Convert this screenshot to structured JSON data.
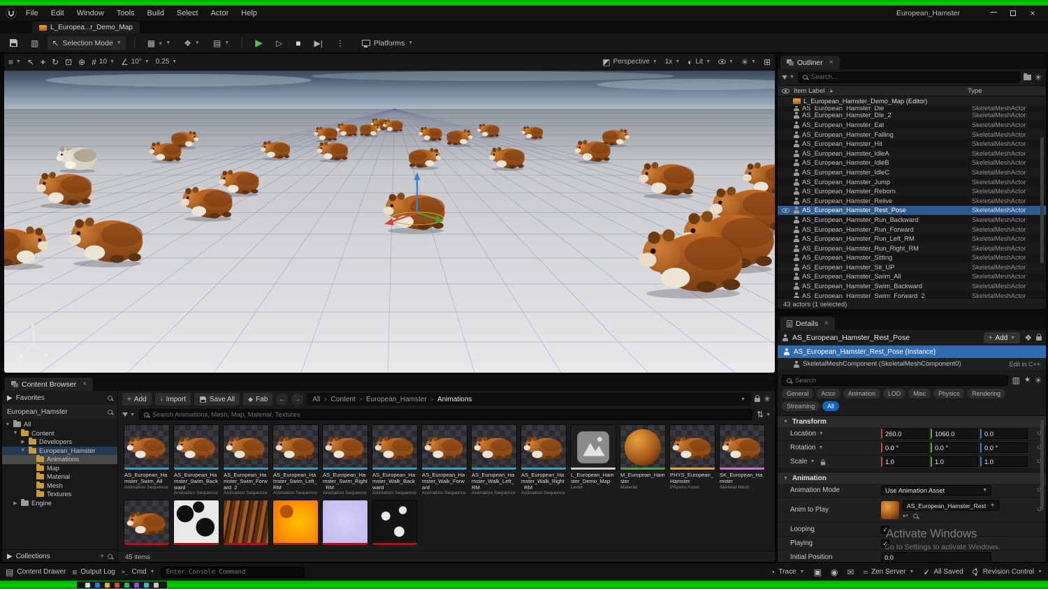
{
  "colors": {
    "accent": "#0070e0",
    "selection_blue": "#2d5a8c",
    "capture_green": "#00c300",
    "play_green": "#58c043",
    "stripes": {
      "anim": "#2f9fd0",
      "level": "#cfcfcf",
      "material": "#3fae49",
      "phys": "#e8a33c",
      "skel": "#d873d8",
      "texture": "#9c1b1b"
    }
  },
  "titlebar": {
    "menus": [
      "File",
      "Edit",
      "Window",
      "Tools",
      "Build",
      "Select",
      "Actor",
      "Help"
    ],
    "project_title": "European_Hamster"
  },
  "tabbar": {
    "level_tab": "L_Europea...r_Demo_Map"
  },
  "main_toolbar": {
    "selection_mode": "Selection Mode",
    "platforms": "Platforms"
  },
  "viewport_toolbar": {
    "perspective": "Perspective",
    "camera_speed": "1x",
    "view_mode": "Lit",
    "snap_move": "10",
    "snap_rotate": "10°",
    "snap_scale": "0.25"
  },
  "scene": {
    "axis": [
      "z",
      "x",
      "y"
    ],
    "gizmo": [
      592,
      196
    ],
    "hamsters": [
      [
        540,
        78,
        0.3,
        "n",
        0
      ],
      [
        558,
        80,
        0.31,
        "n",
        0
      ],
      [
        492,
        86,
        0.33,
        "n",
        0
      ],
      [
        524,
        86,
        0.32,
        "n",
        1
      ],
      [
        695,
        87,
        0.34,
        "n",
        0
      ],
      [
        758,
        90,
        0.33,
        "n",
        0
      ],
      [
        462,
        92,
        0.36,
        "n",
        0
      ],
      [
        612,
        92,
        0.36,
        "n",
        0
      ],
      [
        652,
        97,
        0.4,
        "n",
        1
      ],
      [
        876,
        97,
        0.42,
        "n",
        1
      ],
      [
        258,
        100,
        0.42,
        "n",
        1
      ],
      [
        390,
        115,
        0.45,
        "n",
        0
      ],
      [
        472,
        117,
        0.48,
        "n",
        0
      ],
      [
        845,
        117,
        0.55,
        "n",
        0
      ],
      [
        232,
        118,
        0.5,
        "n",
        0
      ],
      [
        602,
        127,
        0.5,
        "n",
        1
      ],
      [
        722,
        127,
        0.55,
        "n",
        0
      ],
      [
        105,
        128,
        0.62,
        "w",
        0
      ],
      [
        1098,
        157,
        0.8,
        "n",
        0
      ],
      [
        952,
        158,
        0.85,
        "n",
        0
      ],
      [
        338,
        162,
        0.62,
        "n",
        0
      ],
      [
        88,
        172,
        0.85,
        "n",
        0
      ],
      [
        292,
        192,
        0.8,
        "n",
        0
      ],
      [
        1068,
        203,
        1.15,
        "n",
        0
      ],
      [
        590,
        205,
        0.95,
        "n",
        0
      ],
      [
        148,
        247,
        1.15,
        "n",
        0
      ],
      [
        1040,
        247,
        1.45,
        "n",
        0
      ],
      [
        15,
        255,
        1.0,
        "n",
        1
      ],
      [
        988,
        278,
        1.6,
        "n",
        0
      ]
    ]
  },
  "outliner": {
    "tab": "Outliner",
    "search_placeholder": "Search...",
    "col_item": "Item Label",
    "col_type": "Type",
    "world_row": "L_European_Hamster_Demo_Map (Editor)",
    "partial_top": "AS_European_Hamster_Die",
    "type_label": "SkeletalMeshActor",
    "selected": "AS_European_Hamster_Rest_Pose",
    "rows": [
      "AS_European_Hamster_Die_2",
      "AS_European_Hamster_Eat",
      "AS_European_Hamster_Falling",
      "AS_European_Hamster_Hit",
      "AS_European_Hamster_IdleA",
      "AS_European_Hamster_IdleB",
      "AS_European_Hamster_IdleC",
      "AS_European_Hamster_Jump",
      "AS_European_Hamster_Reborn",
      "AS_European_Hamster_Relive",
      "AS_European_Hamster_Rest_Pose",
      "AS_European_Hamster_Run_Backward",
      "AS_European_Hamster_Run_Forward",
      "AS_European_Hamster_Run_Left_RM",
      "AS_European_Hamster_Run_Right_RM",
      "AS_European_Hamster_Sitting",
      "AS_European_Hamster_Sit_UP",
      "AS_European_Hamster_Swim_All",
      "AS_European_Hamster_Swim_Backward",
      "AS_European_Hamster_Swim_Forward_2"
    ],
    "footer": "43 actors (1 selected)"
  },
  "details": {
    "tab": "Details",
    "actor_name": "AS_European_Hamster_Rest_Pose",
    "add_label": "Add",
    "instance_row": "AS_European_Hamster_Rest_Pose (Instance)",
    "component_row": "SkeletalMeshComponent (SkeletalMeshComponent0)",
    "edit_cpp": "Edit in C++",
    "search_placeholder": "Search",
    "filters": [
      "General",
      "Actor",
      "Animation",
      "LOD",
      "Misc",
      "Physics",
      "Rendering",
      "Streaming",
      "All"
    ],
    "active_filter": "All",
    "transform": {
      "section": "Transform",
      "location_label": "Location",
      "location": [
        "260.0",
        "1060.0",
        "0.0"
      ],
      "rotation_label": "Rotation",
      "rotation": [
        "0.0 °",
        "0.0 °",
        "0.0 °"
      ],
      "scale_label": "Scale",
      "scale": [
        "1.0",
        "1.0",
        "1.0"
      ]
    },
    "animation": {
      "section": "Animation",
      "mode_label": "Animation Mode",
      "mode_value": "Use Animation Asset",
      "anim_label": "Anim to Play",
      "anim_value": "AS_European_Hamster_Rest_Pose",
      "looping_label": "Looping",
      "looping_checked": true,
      "playing_label": "Playing",
      "playing_checked": true,
      "initial_label": "Initial Position",
      "initial_value": "0.0"
    }
  },
  "watermark": {
    "line1": "Activate Windows",
    "line2": "Go to Settings to activate Windows."
  },
  "content_browser": {
    "title": "Content Browser",
    "favorites": "Favorites",
    "project_root": "European_Hamster",
    "tree": [
      {
        "label": "All",
        "level": 0,
        "caret": "open",
        "icon": "gray"
      },
      {
        "label": "Content",
        "level": 1,
        "caret": "open",
        "icon": "gold"
      },
      {
        "label": "Developers",
        "level": 2,
        "caret": "closed",
        "icon": "gold"
      },
      {
        "label": "European_Hamster",
        "level": 2,
        "caret": "open",
        "icon": "gold",
        "soft": true
      },
      {
        "label": "Animations",
        "level": 3,
        "caret": "none",
        "icon": "gold",
        "sel": true
      },
      {
        "label": "Map",
        "level": 3,
        "caret": "none",
        "icon": "gold"
      },
      {
        "label": "Material",
        "level": 3,
        "caret": "none",
        "icon": "gold"
      },
      {
        "label": "Mesh",
        "level": 3,
        "caret": "none",
        "icon": "gold"
      },
      {
        "label": "Textures",
        "level": 3,
        "caret": "none",
        "icon": "gold"
      },
      {
        "label": "Engine",
        "level": 1,
        "caret": "closed",
        "icon": "gray"
      }
    ],
    "collections": "Collections",
    "add": "Add",
    "import": "Import",
    "save_all": "Save All",
    "fab": "Fab",
    "breadcrumbs": [
      "All",
      "Content",
      "European_Hamster",
      "Animations"
    ],
    "search_placeholder": "Search Animations, Mesh, Map, Material, Textures",
    "assets": [
      {
        "name": "AS_European_Hamster_Swim_All",
        "type": "Animation Sequence",
        "kind": "anim"
      },
      {
        "name": "AS_European_Hamster_Swim_Backward",
        "type": "Animation Sequence",
        "kind": "anim"
      },
      {
        "name": "AS_European_Hamster_Swim_Forward_2",
        "type": "Animation Sequence",
        "kind": "anim"
      },
      {
        "name": "AS_European_Hamster_Swim_Left_RM",
        "type": "Animation Sequence",
        "kind": "anim"
      },
      {
        "name": "AS_European_Hamster_Swim_Right_RM",
        "type": "Animation Sequence",
        "kind": "anim"
      },
      {
        "name": "AS_European_Hamster_Walk_Backward",
        "type": "Animation Sequence",
        "kind": "anim"
      },
      {
        "name": "AS_European_Hamster_Walk_Forward",
        "type": "Animation Sequence",
        "kind": "anim"
      },
      {
        "name": "AS_European_Hamster_Walk_Left_RM",
        "type": "Animation Sequence",
        "kind": "anim"
      },
      {
        "name": "AS_European_Hamster_Walk_Right_RM",
        "type": "Animation Sequence",
        "kind": "anim"
      },
      {
        "name": "L_European_Hamster_Demo_Map",
        "type": "Level",
        "kind": "level"
      },
      {
        "name": "M_European_Hamster",
        "type": "Material",
        "kind": "material"
      },
      {
        "name": "PHYS_European_Hamster",
        "type": "Physics Asset",
        "kind": "phys"
      },
      {
        "name": "SK_European_Hamster",
        "type": "Skeletal Mesh",
        "kind": "skel"
      }
    ],
    "textures": [
      "ham",
      "mask",
      "fur",
      "orange",
      "normal",
      "spots"
    ],
    "items_count": "45 items"
  },
  "statusbar": {
    "content_drawer": "Content Drawer",
    "output_log": "Output Log",
    "cmd": "Cmd",
    "console_placeholder": "Enter Console Command",
    "trace": "Trace",
    "zen_server": "Zen Server",
    "all_saved": "All Saved",
    "revision_control": "Revision Control",
    "taskbar_colors": [
      "#d8d8d8",
      "#3a76d2",
      "#e0b23a",
      "#d24a3a",
      "#44b054",
      "#8a55c8",
      "#3ab5d6",
      "#c8c8c8"
    ]
  }
}
